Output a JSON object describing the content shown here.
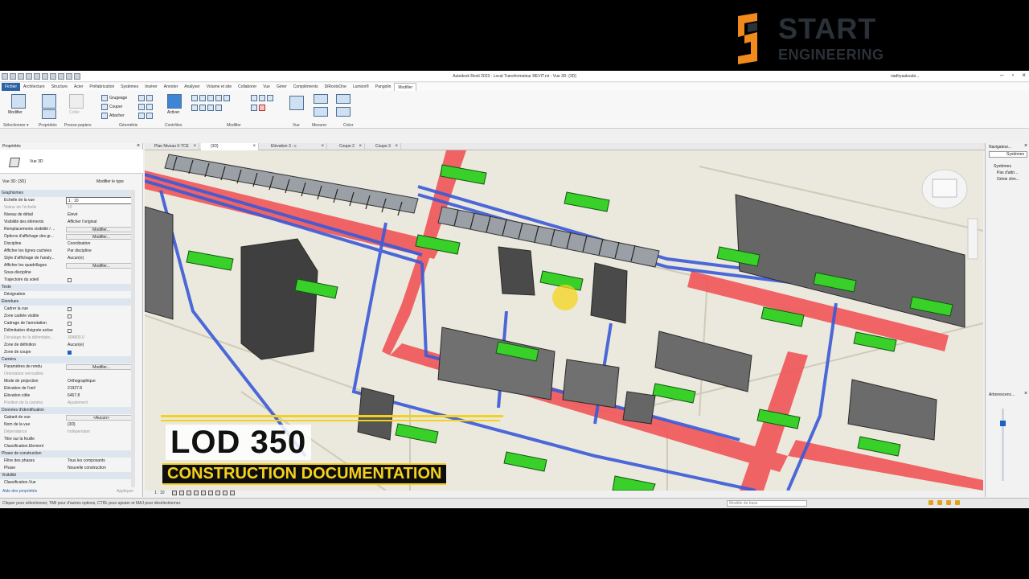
{
  "window": {
    "title": "Autodesk Revit 2023 - Local Transformateur REVIT.rvt - Vue 3D: {3D}",
    "user": "riadhyaakoubi..."
  },
  "menu": {
    "items": [
      "Fichier",
      "Architecture",
      "Structure",
      "Acier",
      "Préfabrication",
      "Systèmes",
      "Insérer",
      "Annoter",
      "Analyser",
      "Volume et site",
      "Collaborer",
      "Vue",
      "Gérer",
      "Compléments",
      "DiRootsOne",
      "Lumion®",
      "Pangolin",
      "Modifier"
    ]
  },
  "ribbon": {
    "modify_label": "Modifier",
    "select_label": "Sélectionner",
    "group_labels": [
      "Propriétés",
      "Presse-papiers",
      "Géométrie",
      "Contrôles",
      "Modifier",
      "Vue",
      "Mesurer",
      "Créer"
    ],
    "geometry_items": [
      "Grugeage",
      "Couper",
      "Attacher"
    ],
    "activate_label": "Activer",
    "paste_label": "Coller"
  },
  "brand": {
    "line1": "START",
    "line2": "ENGINEERING",
    "colors": {
      "orange": "#f08a1c",
      "grey": "#2b3138"
    }
  },
  "properties": {
    "title": "Propriétés",
    "type_label": "Vue 3D",
    "selector": "Vue 3D: {3D}",
    "edit_type": "Modifier le type",
    "rows": [
      {
        "k": "Graphismes",
        "cat": true
      },
      {
        "k": "Echelle de la vue",
        "v": "1 : 10",
        "style": "input"
      },
      {
        "k": "Valeur de l'échelle",
        "v": "10",
        "style": "grey"
      },
      {
        "k": "Niveau de détail",
        "v": "Elevé"
      },
      {
        "k": "Visibilité des éléments",
        "v": "Afficher l'original"
      },
      {
        "k": "Remplacements visibilité / ...",
        "v": "Modifier...",
        "style": "btn"
      },
      {
        "k": "Options d'affichage des gr...",
        "v": "Modifier...",
        "style": "btn"
      },
      {
        "k": "Discipline",
        "v": "Coordination"
      },
      {
        "k": "Afficher les lignes cachées",
        "v": "Par discipline"
      },
      {
        "k": "Style d'affichage de l'analy...",
        "v": "Aucun(e)"
      },
      {
        "k": "Afficher les quadrillages",
        "v": "Modifier...",
        "style": "btn"
      },
      {
        "k": "Sous-discipline",
        "v": ""
      },
      {
        "k": "Trajectoire du soleil",
        "check": false
      },
      {
        "k": "Texte",
        "cat": true
      },
      {
        "k": "Désignation",
        "v": ""
      },
      {
        "k": "Etendues",
        "cat": true
      },
      {
        "k": "Cadrer la vue",
        "check": false
      },
      {
        "k": "Zone cadrée visible",
        "check": false
      },
      {
        "k": "Cadrage de l'annotation",
        "check": false
      },
      {
        "k": "Délimitation éloignée active",
        "check": false
      },
      {
        "k": "Décalage de la délimitatio...",
        "v": "304800.0",
        "style": "grey"
      },
      {
        "k": "Zone de définition",
        "v": "Aucun(e)"
      },
      {
        "k": "Zone de coupe",
        "check": true
      },
      {
        "k": "Caméra",
        "cat": true
      },
      {
        "k": "Paramètres de rendu",
        "v": "Modifier...",
        "style": "btn"
      },
      {
        "k": "Orientation verrouillée",
        "v": "",
        "style": "grey"
      },
      {
        "k": "Mode de projection",
        "v": "Orthographique"
      },
      {
        "k": "Elévation de l'oeil",
        "v": "21927.8"
      },
      {
        "k": "Elévation cible",
        "v": "6467.8"
      },
      {
        "k": "Position de la caméra",
        "v": "Ajustement",
        "style": "grey"
      },
      {
        "k": "Données d'identification",
        "cat": true
      },
      {
        "k": "Gabarit de vue",
        "v": "<Aucun>",
        "style": "btn"
      },
      {
        "k": "Nom de la vue",
        "v": "{3D}"
      },
      {
        "k": "Dépendance",
        "v": "Indépendant",
        "style": "grey"
      },
      {
        "k": "Titre sur la feuille",
        "v": ""
      },
      {
        "k": "Classification.Element",
        "v": ""
      },
      {
        "k": "Phase de construction",
        "cat": true
      },
      {
        "k": "Filtre des phases",
        "v": "Tous les composants"
      },
      {
        "k": "Phase",
        "v": "Nouvelle construction"
      },
      {
        "k": "Visibilité",
        "cat": true
      },
      {
        "k": "Classification.Vue",
        "v": ""
      }
    ],
    "help_link": "Aide des propriétés",
    "apply": "Appliquer"
  },
  "tabs": [
    {
      "label": "Plan Niveau 0-TCE",
      "active": false
    },
    {
      "label": "{3D}",
      "active": true
    },
    {
      "label": "Elévation 3 - c",
      "active": false
    },
    {
      "label": "Coupe 2",
      "active": false
    },
    {
      "label": "Coupe 3",
      "active": false
    }
  ],
  "view_controls": {
    "scale": "1 : 10"
  },
  "navigator": {
    "title": "Navigateur...",
    "combo": "Systèmes",
    "tree_root": "Systèmes",
    "tree_items": [
      "Pas d'attri...",
      "Génie clim..."
    ],
    "arbo_title": "Arborescenc..."
  },
  "status": {
    "text": "Cliquer pour sélectionner, TAB pour d'autres options, CTRL pour ajouter et MAJ pour désélectionner.",
    "model": "Modèle de base"
  },
  "overlay": {
    "title": "LOD 350",
    "subtitle": "CONSTRUCTION DOCUMENTATION",
    "accent": "#f4d11c"
  },
  "scene_colors": {
    "floor": "#ebe9dd",
    "red_duct": "#f0585a",
    "blue_pipe": "#3a5ad8",
    "green_tag": "#3ad02a",
    "equipment": "#6a6a6a"
  }
}
